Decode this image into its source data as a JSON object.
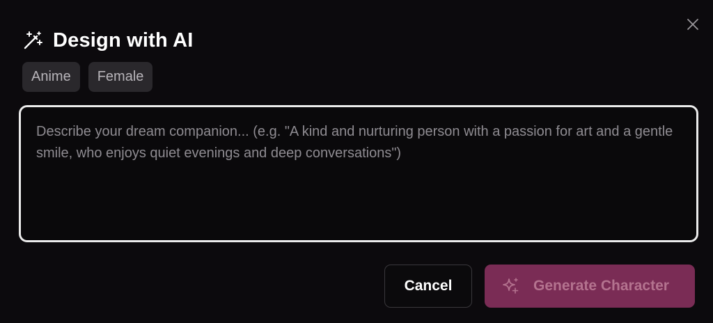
{
  "dialog": {
    "title": "Design with AI",
    "title_icon": "magic-wand-icon",
    "close_icon": "close-icon"
  },
  "tags": [
    {
      "label": "Anime"
    },
    {
      "label": "Female"
    }
  ],
  "prompt": {
    "value": "",
    "placeholder": "Describe your dream companion... (e.g. \"A kind and nurturing person with a passion for art and a gentle smile, who enjoys quiet evenings and deep conversations\")"
  },
  "actions": {
    "cancel_label": "Cancel",
    "generate_label": "Generate Character",
    "generate_icon": "sparkles-icon"
  },
  "colors": {
    "background": "#0c0a0d",
    "tag_bg": "#2a282c",
    "generate_bg": "#7a2c55",
    "generate_text": "#b4738f",
    "input_border": "#ececec"
  }
}
